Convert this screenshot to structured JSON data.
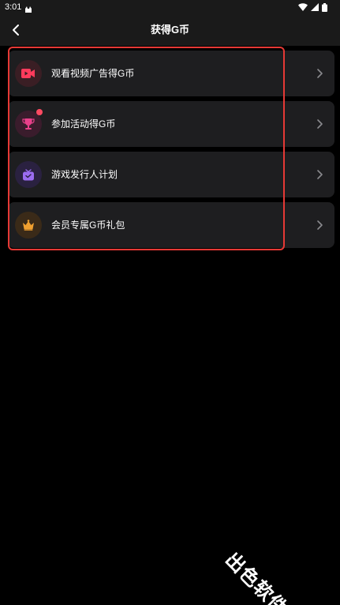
{
  "status_bar": {
    "time": "3:01"
  },
  "header": {
    "title": "获得G币"
  },
  "items": [
    {
      "label": "观看视频广告得G币",
      "icon": "video-play-icon",
      "icon_color": "#ff3b5c",
      "icon_bg": "#3a1e24",
      "badge": false
    },
    {
      "label": "参加活动得G币",
      "icon": "trophy-icon",
      "icon_color": "#e8408a",
      "icon_bg": "#3a1c2c",
      "badge": true
    },
    {
      "label": "游戏发行人计划",
      "icon": "tv-icon",
      "icon_color": "#9b6cf0",
      "icon_bg": "#2a2140",
      "badge": false
    },
    {
      "label": "会员专属G币礼包",
      "icon": "crown-icon",
      "icon_color": "#f0a030",
      "icon_bg": "#3a2a18",
      "badge": false
    }
  ],
  "colors": {
    "background": "#000000",
    "card": "#1e1e20",
    "highlight": "#e53935",
    "badge": "#ff4a62"
  },
  "watermark": "出色软件站"
}
